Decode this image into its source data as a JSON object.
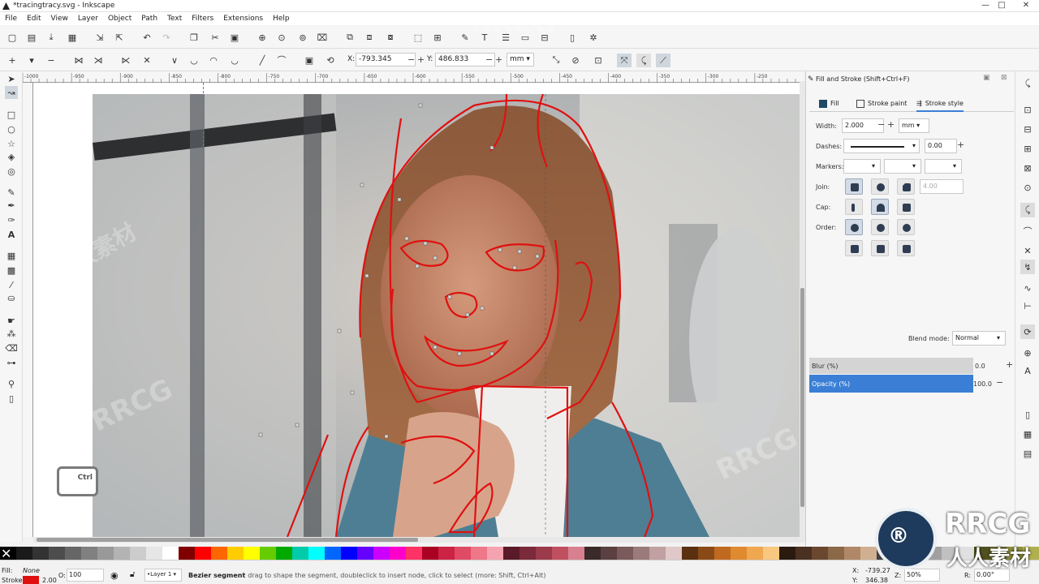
{
  "window": {
    "title": "*tracingtracy.svg - Inkscape",
    "controls": [
      "—",
      "□",
      "✕"
    ]
  },
  "menu": [
    "File",
    "Edit",
    "View",
    "Layer",
    "Object",
    "Path",
    "Text",
    "Filters",
    "Extensions",
    "Help"
  ],
  "tool_controls": {
    "x_label": "X:",
    "x_value": "-793.345",
    "y_label": "Y:",
    "y_value": "486.833",
    "unit": "mm"
  },
  "panel": {
    "header": "Fill and Stroke (Shift+Ctrl+F)",
    "tabs": [
      "Fill",
      "Stroke paint",
      "Stroke style"
    ],
    "active_tab": "Stroke style",
    "width_label": "Width:",
    "width_value": "2.000",
    "width_unit": "mm",
    "dashes_label": "Dashes:",
    "dash_offset": "0.00",
    "markers_label": "Markers:",
    "join_label": "Join:",
    "miter_value": "4.00",
    "cap_label": "Cap:",
    "order_label": "Order:",
    "blend_label": "Blend mode:",
    "blend_value": "Normal",
    "blur_label": "Blur (%)",
    "blur_value": "0.0",
    "opacity_label": "Opacity (%)",
    "opacity_value": "100.0"
  },
  "ctrl_badge": "Ctrl",
  "ruler_ticks": [
    "-1000",
    "-950",
    "-900",
    "-850",
    "-800",
    "-750",
    "-700",
    "-650",
    "-600",
    "-550",
    "-500",
    "-450",
    "-400",
    "-350",
    "-300",
    "-250"
  ],
  "status": {
    "fill_label": "Fill:",
    "fill_value": "None",
    "stroke_label": "Stroke:",
    "stroke_width": "2.00",
    "opacity_label": "O:",
    "opacity_value": "100",
    "layer": "•Layer 1",
    "tool_name": "Bezier segment",
    "message": ": drag to shape the segment, doubleclick to insert node, click to select (more: Shift, Ctrl+Alt)",
    "x_label": "X:",
    "x_value": "-739.27",
    "y_label": "Y:",
    "y_value": "346.38",
    "zoom_label": "Z:",
    "zoom_value": "50%",
    "rotate_label": "R:",
    "rotate_value": "0.00°"
  },
  "watermark": {
    "brand": "RRCG",
    "subtitle": "人人素材"
  },
  "colors": {
    "accent": "#3a7fd5",
    "stroke_red": "#e01010"
  }
}
